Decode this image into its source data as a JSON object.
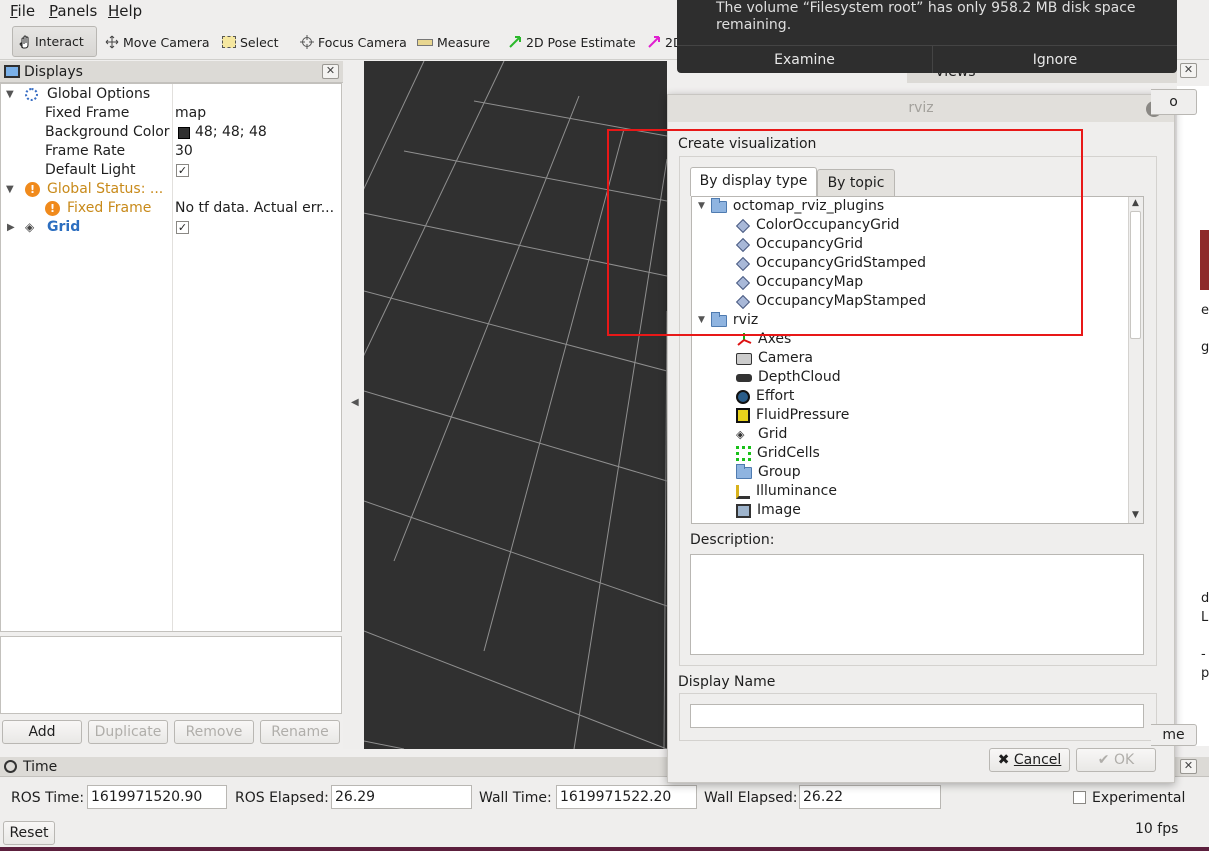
{
  "menu": {
    "file": "File",
    "panels": "Panels",
    "help": "Help"
  },
  "toolbar": {
    "interact": "Interact",
    "move_camera": "Move Camera",
    "select": "Select",
    "focus_camera": "Focus Camera",
    "measure": "Measure",
    "pose_estimate": "2D Pose Estimate",
    "nav_goal_truncated": "2D"
  },
  "notification": {
    "message": "The volume “Filesystem root” has only 958.2 MB disk space remaining.",
    "examine": "Examine",
    "ignore": "Ignore"
  },
  "displays": {
    "title": "Displays",
    "global_options": "Global Options",
    "fixed_frame_label": "Fixed Frame",
    "fixed_frame_value": "map",
    "background_color_label": "Background Color",
    "background_color_value": "48; 48; 48",
    "frame_rate_label": "Frame Rate",
    "frame_rate_value": "30",
    "default_light_label": "Default Light",
    "global_status_label": "Global Status: ...",
    "status_fixed_frame_label": "Fixed Frame",
    "status_fixed_frame_value": "No tf data.  Actual err...",
    "grid_label": "Grid",
    "colors": {
      "warning": "#c88a1a",
      "grid_blue": "#2c6ec0",
      "swatch": "#303030"
    }
  },
  "buttons": {
    "add": "Add",
    "duplicate": "Duplicate",
    "remove": "Remove",
    "rename": "Rename"
  },
  "views": {
    "title": "Views",
    "partial_button": "o",
    "partial_bottom_button": "me"
  },
  "dialog": {
    "title": "rviz",
    "heading": "Create visualization",
    "tab_display_type": "By display type",
    "tab_topic": "By topic",
    "groups": [
      {
        "name": "octomap_rviz_plugins",
        "items": [
          "ColorOccupancyGrid",
          "OccupancyGrid",
          "OccupancyGridStamped",
          "OccupancyMap",
          "OccupancyMapStamped"
        ]
      },
      {
        "name": "rviz",
        "items": [
          "Axes",
          "Camera",
          "DepthCloud",
          "Effort",
          "FluidPressure",
          "Grid",
          "GridCells",
          "Group",
          "Illuminance",
          "Image"
        ]
      }
    ],
    "description_label": "Description:",
    "display_name_label": "Display Name",
    "display_name_value": "",
    "cancel": "Cancel",
    "ok": "OK"
  },
  "time": {
    "title": "Time",
    "ros_time_label": "ROS Time:",
    "ros_time_value": "1619971520.90",
    "ros_elapsed_label": "ROS Elapsed:",
    "ros_elapsed_value": "26.29",
    "wall_time_label": "Wall Time:",
    "wall_time_value": "1619971522.20",
    "wall_elapsed_label": "Wall Elapsed:",
    "wall_elapsed_value": "26.22",
    "experimental": "Experimental",
    "reset": "Reset",
    "fps": "10 fps"
  },
  "background_edge_chars": [
    "e",
    "g",
    "d",
    "L",
    "-",
    "p"
  ]
}
